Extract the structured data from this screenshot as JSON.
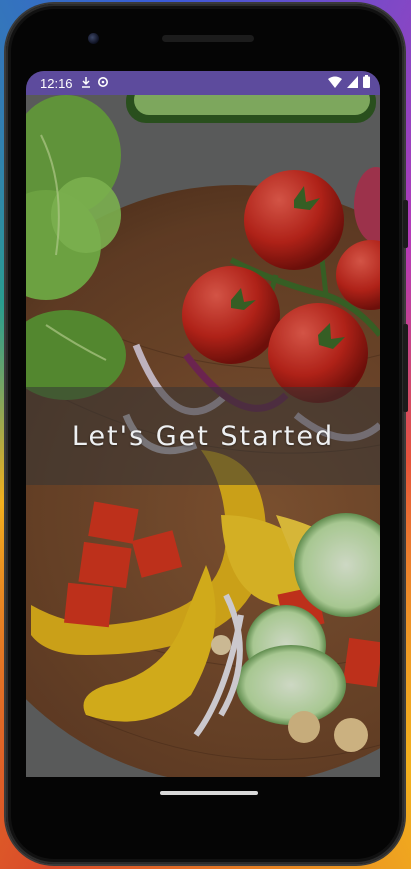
{
  "status_bar": {
    "time": "12:16",
    "left_icons": [
      "download-icon",
      "sync-icon"
    ],
    "right_icons": [
      "wifi-icon",
      "cellular-signal-icon",
      "battery-icon"
    ],
    "color": "#5d4b9d"
  },
  "hero": {
    "title": "Let's Get Started",
    "background_image": "vegetables-on-wooden-board"
  },
  "navigation": {
    "gesture_bar": "home-gesture-pill"
  }
}
